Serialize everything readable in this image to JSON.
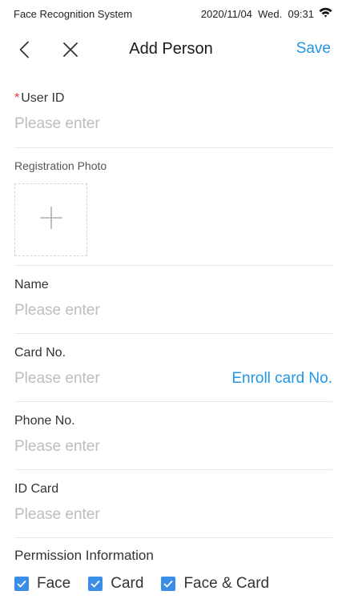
{
  "status_bar": {
    "app_name": "Face Recognition System",
    "datetime": "2020/11/04  Wed.  09:31",
    "wifi_icon": "wifi-icon"
  },
  "nav": {
    "back_icon": "chevron-left-icon",
    "close_icon": "close-icon",
    "title": "Add Person",
    "save_label": "Save"
  },
  "form": {
    "user_id": {
      "required_mark": "*",
      "label": "User ID",
      "placeholder": "Please enter",
      "value": ""
    },
    "registration_photo": {
      "label": "Registration Photo",
      "add_icon": "plus-icon"
    },
    "name": {
      "label": "Name",
      "placeholder": "Please enter",
      "value": ""
    },
    "card_no": {
      "label": "Card No.",
      "placeholder": "Please enter",
      "value": "",
      "link": "Enroll card No."
    },
    "phone_no": {
      "label": "Phone No.",
      "placeholder": "Please enter",
      "value": ""
    },
    "id_card": {
      "label": "ID Card",
      "placeholder": "Please enter",
      "value": ""
    }
  },
  "permission": {
    "label": "Permission Information",
    "options": [
      {
        "label": "Face",
        "checked": true
      },
      {
        "label": "Card",
        "checked": true
      },
      {
        "label": "Face & Card",
        "checked": true
      }
    ]
  },
  "colors": {
    "accent": "#2196e6",
    "checkbox": "#3a8ee6",
    "required": "#e8383d",
    "placeholder": "#bdbdbd"
  }
}
